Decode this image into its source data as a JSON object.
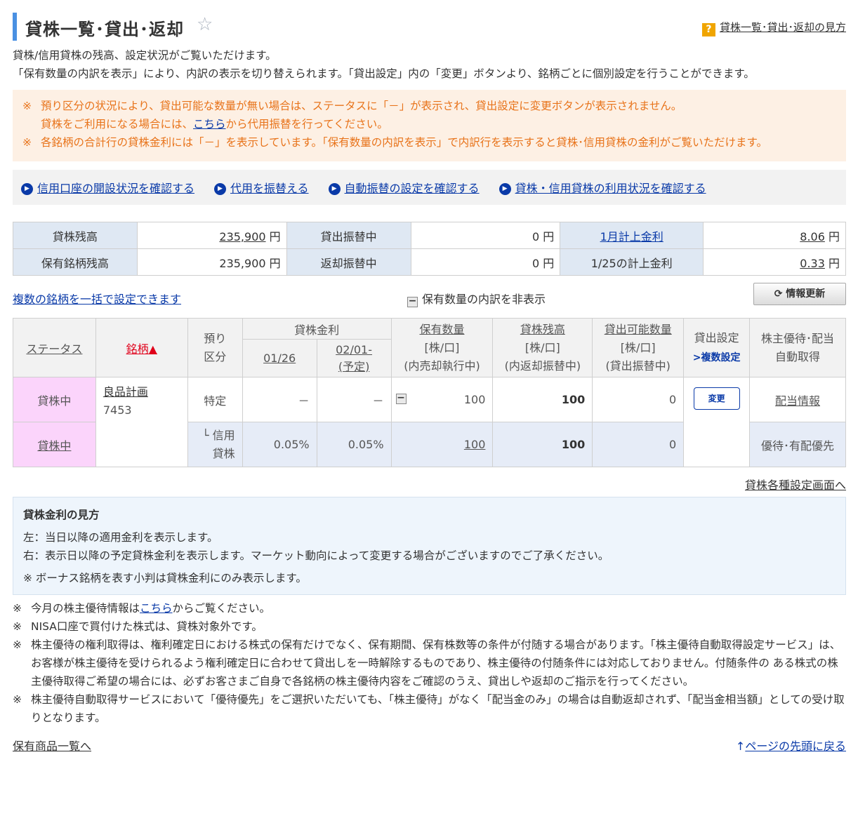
{
  "header": {
    "title": "貸株一覧･貸出･返却",
    "help_label": "貸株一覧･貸出･返却の見方"
  },
  "intro": [
    "貸株/信用貸株の残高、設定状況がご覧いただけます。",
    "「保有数量の内訳を表示」により、内訳の表示を切り替えられます。「貸出設定」内の「変更」ボタンより、銘柄ごとに個別設定を行うことができます。"
  ],
  "notice": {
    "mark": "※",
    "line1": "預り区分の状況により、貸出可能な数量が無い場合は、ステータスに「－」が表示され、貸出設定に変更ボタンが表示されません。",
    "line2_pre": "貸株をご利用になる場合には、",
    "line2_link": "こちら",
    "line2_post": "から代用振替を行ってください。",
    "line3": "各銘柄の合計行の貸株金利には「－」を表示しています。「保有数量の内訳を表示」で内訳行を表示すると貸株･信用貸株の金利がご覧いただけます。"
  },
  "links": [
    "信用口座の開設状況を確認する",
    "代用を振替える",
    "自動振替の設定を確認する",
    "貸株・信用貸株の利用状況を確認する"
  ],
  "summary": {
    "r1": {
      "l1": "貸株残高",
      "v1": "235,900",
      "u1": "円",
      "l2": "貸出振替中",
      "v2": "0",
      "u2": "円",
      "l3": "1月計上金利",
      "v3": "8.06",
      "u3": "円"
    },
    "r2": {
      "l1": "保有銘柄残高",
      "v1": "235,900",
      "u1": "円",
      "l2": "返却振替中",
      "v2": "0",
      "u2": "円",
      "l3": "1/25の計上金利",
      "v3": "0.33",
      "u3": "円"
    }
  },
  "controls": {
    "bulk_link": "複数の銘柄を一括で設定できます",
    "toggle_label": "保有数量の内訳を非表示",
    "refresh_label": "情報更新"
  },
  "table": {
    "headers": {
      "status": "ステータス",
      "meigara": "銘柄",
      "sort_mark": "▲",
      "azukari1": "預り",
      "azukari2": "区分",
      "kinri": "貸株金利",
      "date1": "01/26",
      "date2a": "02/01-",
      "date2b": "(予定)",
      "hoyu1": "保有数量",
      "hoyu2": "[株/口]",
      "hoyu3": "(内売却執行中)",
      "zandaka1": "貸株残高",
      "zandaka2": "[株/口]",
      "zandaka3": "(内返却振替中)",
      "kano1": "貸出可能数量",
      "kano2": "[株/口]",
      "kano3": "(貸出振替中)",
      "settei": "貸出設定",
      "fukusu": "複数設定",
      "yutai1": "株主優待･配当",
      "yutai2": "自動取得"
    },
    "row1": {
      "status": "貸株中",
      "name": "良品計画",
      "code": "7453",
      "azukari": "特定",
      "rate1": "－",
      "rate2": "－",
      "hoyu": "100",
      "zandaka": "100",
      "kano": "0",
      "change_btn": "変更",
      "yutai": "配当情報"
    },
    "row2": {
      "status": "貸株中",
      "azukari_a": "└ 信用",
      "azukari_b": "貸株",
      "rate1": "0.05%",
      "rate2": "0.05%",
      "hoyu": "100",
      "zandaka": "100",
      "kano": "0",
      "yutai": "優待･有配優先"
    }
  },
  "settings_link": "貸株各種設定画面へ",
  "info": {
    "title": "貸株金利の見方",
    "line1": "左：当日以降の適用金利を表示します。",
    "line2": "右：表示日以降の予定貸株金利を表示します。マーケット動向によって変更する場合がございますのでご了承ください。",
    "line3": "※ ボーナス銘柄を表す小判は貸株金利にのみ表示します。"
  },
  "notes": {
    "mark": "※",
    "n1_pre": "今月の株主優待情報は",
    "n1_link": "こちら",
    "n1_post": "からご覧ください。",
    "n2": "NISA口座で買付けた株式は、貸株対象外です。",
    "n3": "株主優待の権利取得は、権利確定日における株式の保有だけでなく、保有期間、保有株数等の条件が付随する場合があります。「株主優待自動取得設定サービス」は、お客様が株主優待を受けられるよう権利確定日に合わせて貸出しを一時解除するものであり、株主優待の付随条件には対応しておりません。付随条件の ある株式の株主優待取得ご希望の場合には、必ずお客さまご自身で各銘柄の株主優待内容をご確認のうえ、貸出しや返却のご指示を行ってください。",
    "n4": "株主優待自動取得サービスにおいて「優待優先」をご選択いただいても、「株主優待」がなく「配当金のみ」の場合は自動返却されず、「配当金相当額」としての受け取りとなります。"
  },
  "footer": {
    "left_link": "保有商品一覧へ",
    "right_link": "ページの先頭に戻る",
    "up_arrow": "↑"
  }
}
